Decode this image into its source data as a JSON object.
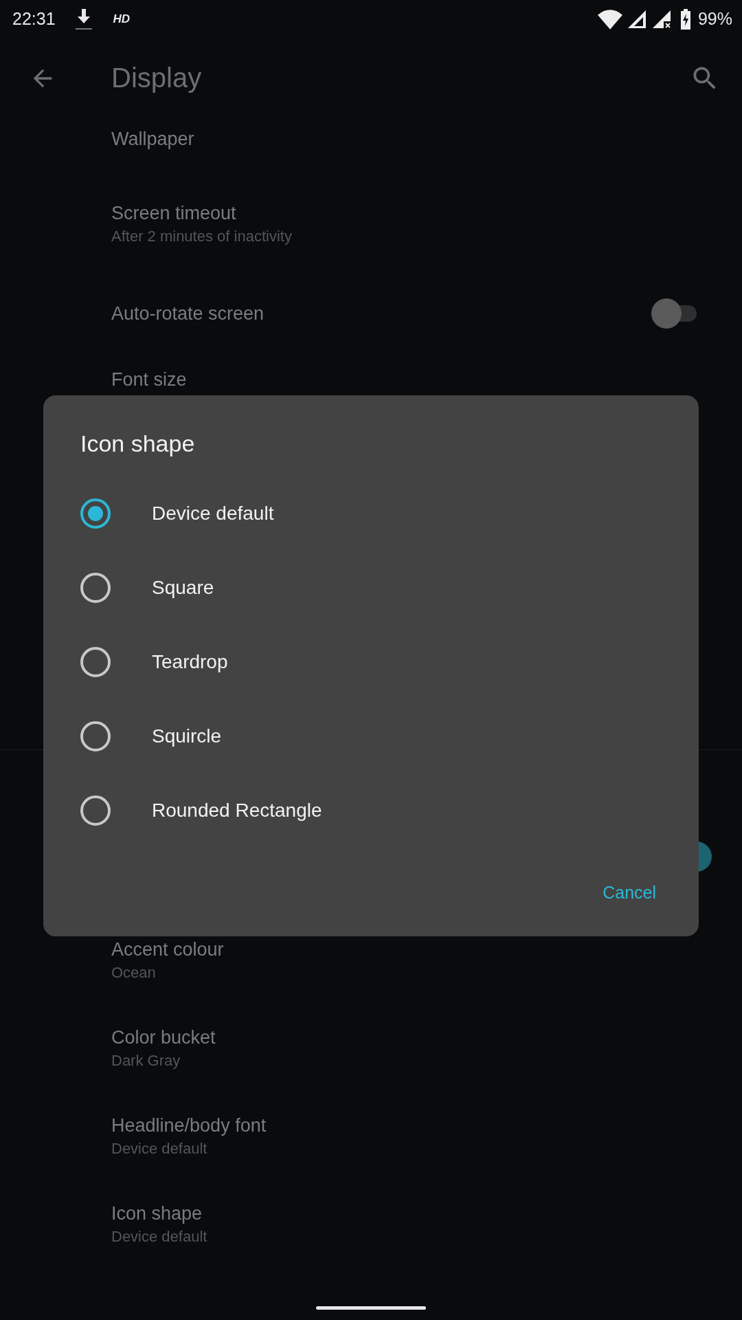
{
  "status_bar": {
    "time": "22:31",
    "hd_label": "HD",
    "battery": "99%"
  },
  "app_bar": {
    "title": "Display"
  },
  "settings": [
    {
      "title": "Wallpaper"
    },
    {
      "title": "Screen timeout",
      "summary": "After 2 minutes of inactivity"
    },
    {
      "title": "Auto-rotate screen",
      "switch_on": false
    },
    {
      "title": "Font size"
    }
  ],
  "hidden_switch": {
    "on": true
  },
  "settings_lower": [
    {
      "title": "Accent colour",
      "summary": "Ocean"
    },
    {
      "title": "Color bucket",
      "summary": "Dark Gray"
    },
    {
      "title": "Headline/body font",
      "summary": "Device default"
    },
    {
      "title": "Icon shape",
      "summary": "Device default"
    }
  ],
  "dialog": {
    "title": "Icon shape",
    "options": [
      {
        "label": "Device default",
        "selected": true
      },
      {
        "label": "Square",
        "selected": false
      },
      {
        "label": "Teardrop",
        "selected": false
      },
      {
        "label": "Squircle",
        "selected": false
      },
      {
        "label": "Rounded Rectangle",
        "selected": false
      }
    ],
    "cancel": "Cancel"
  }
}
